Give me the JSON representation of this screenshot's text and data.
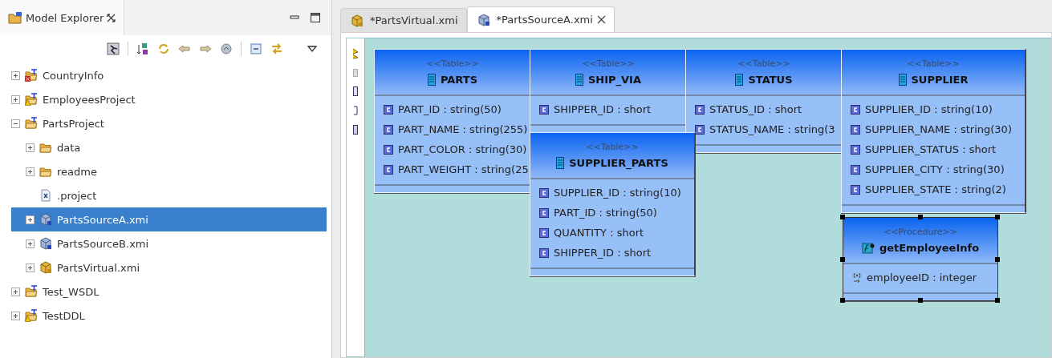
{
  "explorer": {
    "title": "Model Explorer",
    "tree": [
      {
        "label": "CountryInfo",
        "kind": "project",
        "error": true,
        "warning": false,
        "expanded": false,
        "selected": false
      },
      {
        "label": "EmployeesProject",
        "kind": "project",
        "error": false,
        "warning": true,
        "expanded": false,
        "selected": false
      },
      {
        "label": "PartsProject",
        "kind": "project",
        "error": false,
        "warning": false,
        "expanded": true,
        "selected": false,
        "children": [
          {
            "label": "data",
            "kind": "folder",
            "expanded": false,
            "selected": false
          },
          {
            "label": "readme",
            "kind": "folder",
            "expanded": false,
            "selected": false
          },
          {
            "label": ".project",
            "kind": "file",
            "selected": false
          },
          {
            "label": "PartsSourceA.xmi",
            "kind": "source-model",
            "expanded": false,
            "selected": true
          },
          {
            "label": "PartsSourceB.xmi",
            "kind": "source-model",
            "expanded": false,
            "selected": false
          },
          {
            "label": "PartsVirtual.xmi",
            "kind": "virtual-model",
            "expanded": false,
            "selected": false
          }
        ]
      },
      {
        "label": "Test_WSDL",
        "kind": "project",
        "error": false,
        "warning": false,
        "expanded": false,
        "selected": false
      },
      {
        "label": "TestDDL",
        "kind": "project",
        "error": false,
        "warning": true,
        "expanded": false,
        "selected": false
      }
    ]
  },
  "editor": {
    "tabs": [
      {
        "label": "*PartsVirtual.xmi",
        "kind": "virtual-model",
        "selected": false
      },
      {
        "label": "*PartsSourceA.xmi",
        "kind": "source-model",
        "selected": true
      }
    ],
    "nodes": [
      {
        "kind": "table",
        "stereotype": "<<Table>>",
        "name": "PARTS",
        "selected": false,
        "columns": [
          "PART_ID : string(50)",
          "PART_NAME : string(255)",
          "PART_COLOR : string(30)",
          "PART_WEIGHT : string(25"
        ]
      },
      {
        "kind": "table",
        "stereotype": "<<Table>>",
        "name": "SHIP_VIA",
        "selected": false,
        "columns": [
          "SHIPPER_ID : short"
        ]
      },
      {
        "kind": "table",
        "stereotype": "<<Table>>",
        "name": "STATUS",
        "selected": false,
        "columns": [
          "STATUS_ID : short",
          "STATUS_NAME : string(3"
        ]
      },
      {
        "kind": "table",
        "stereotype": "<<Table>>",
        "name": "SUPPLIER",
        "selected": false,
        "columns": [
          "SUPPLIER_ID : string(10)",
          "SUPPLIER_NAME : string(30)",
          "SUPPLIER_STATUS : short",
          "SUPPLIER_CITY : string(30)",
          "SUPPLIER_STATE : string(2)"
        ]
      },
      {
        "kind": "table",
        "stereotype": "<<Table>>",
        "name": "SUPPLIER_PARTS",
        "selected": false,
        "columns": [
          "SUPPLIER_ID : string(10)",
          "PART_ID : string(50)",
          "QUANTITY : short",
          "SHIPPER_ID : short"
        ]
      },
      {
        "kind": "procedure",
        "stereotype": "<<Procedure>>",
        "name": "getEmployeeInfo",
        "selected": true,
        "columns": [
          "employeeID : integer"
        ]
      }
    ]
  }
}
